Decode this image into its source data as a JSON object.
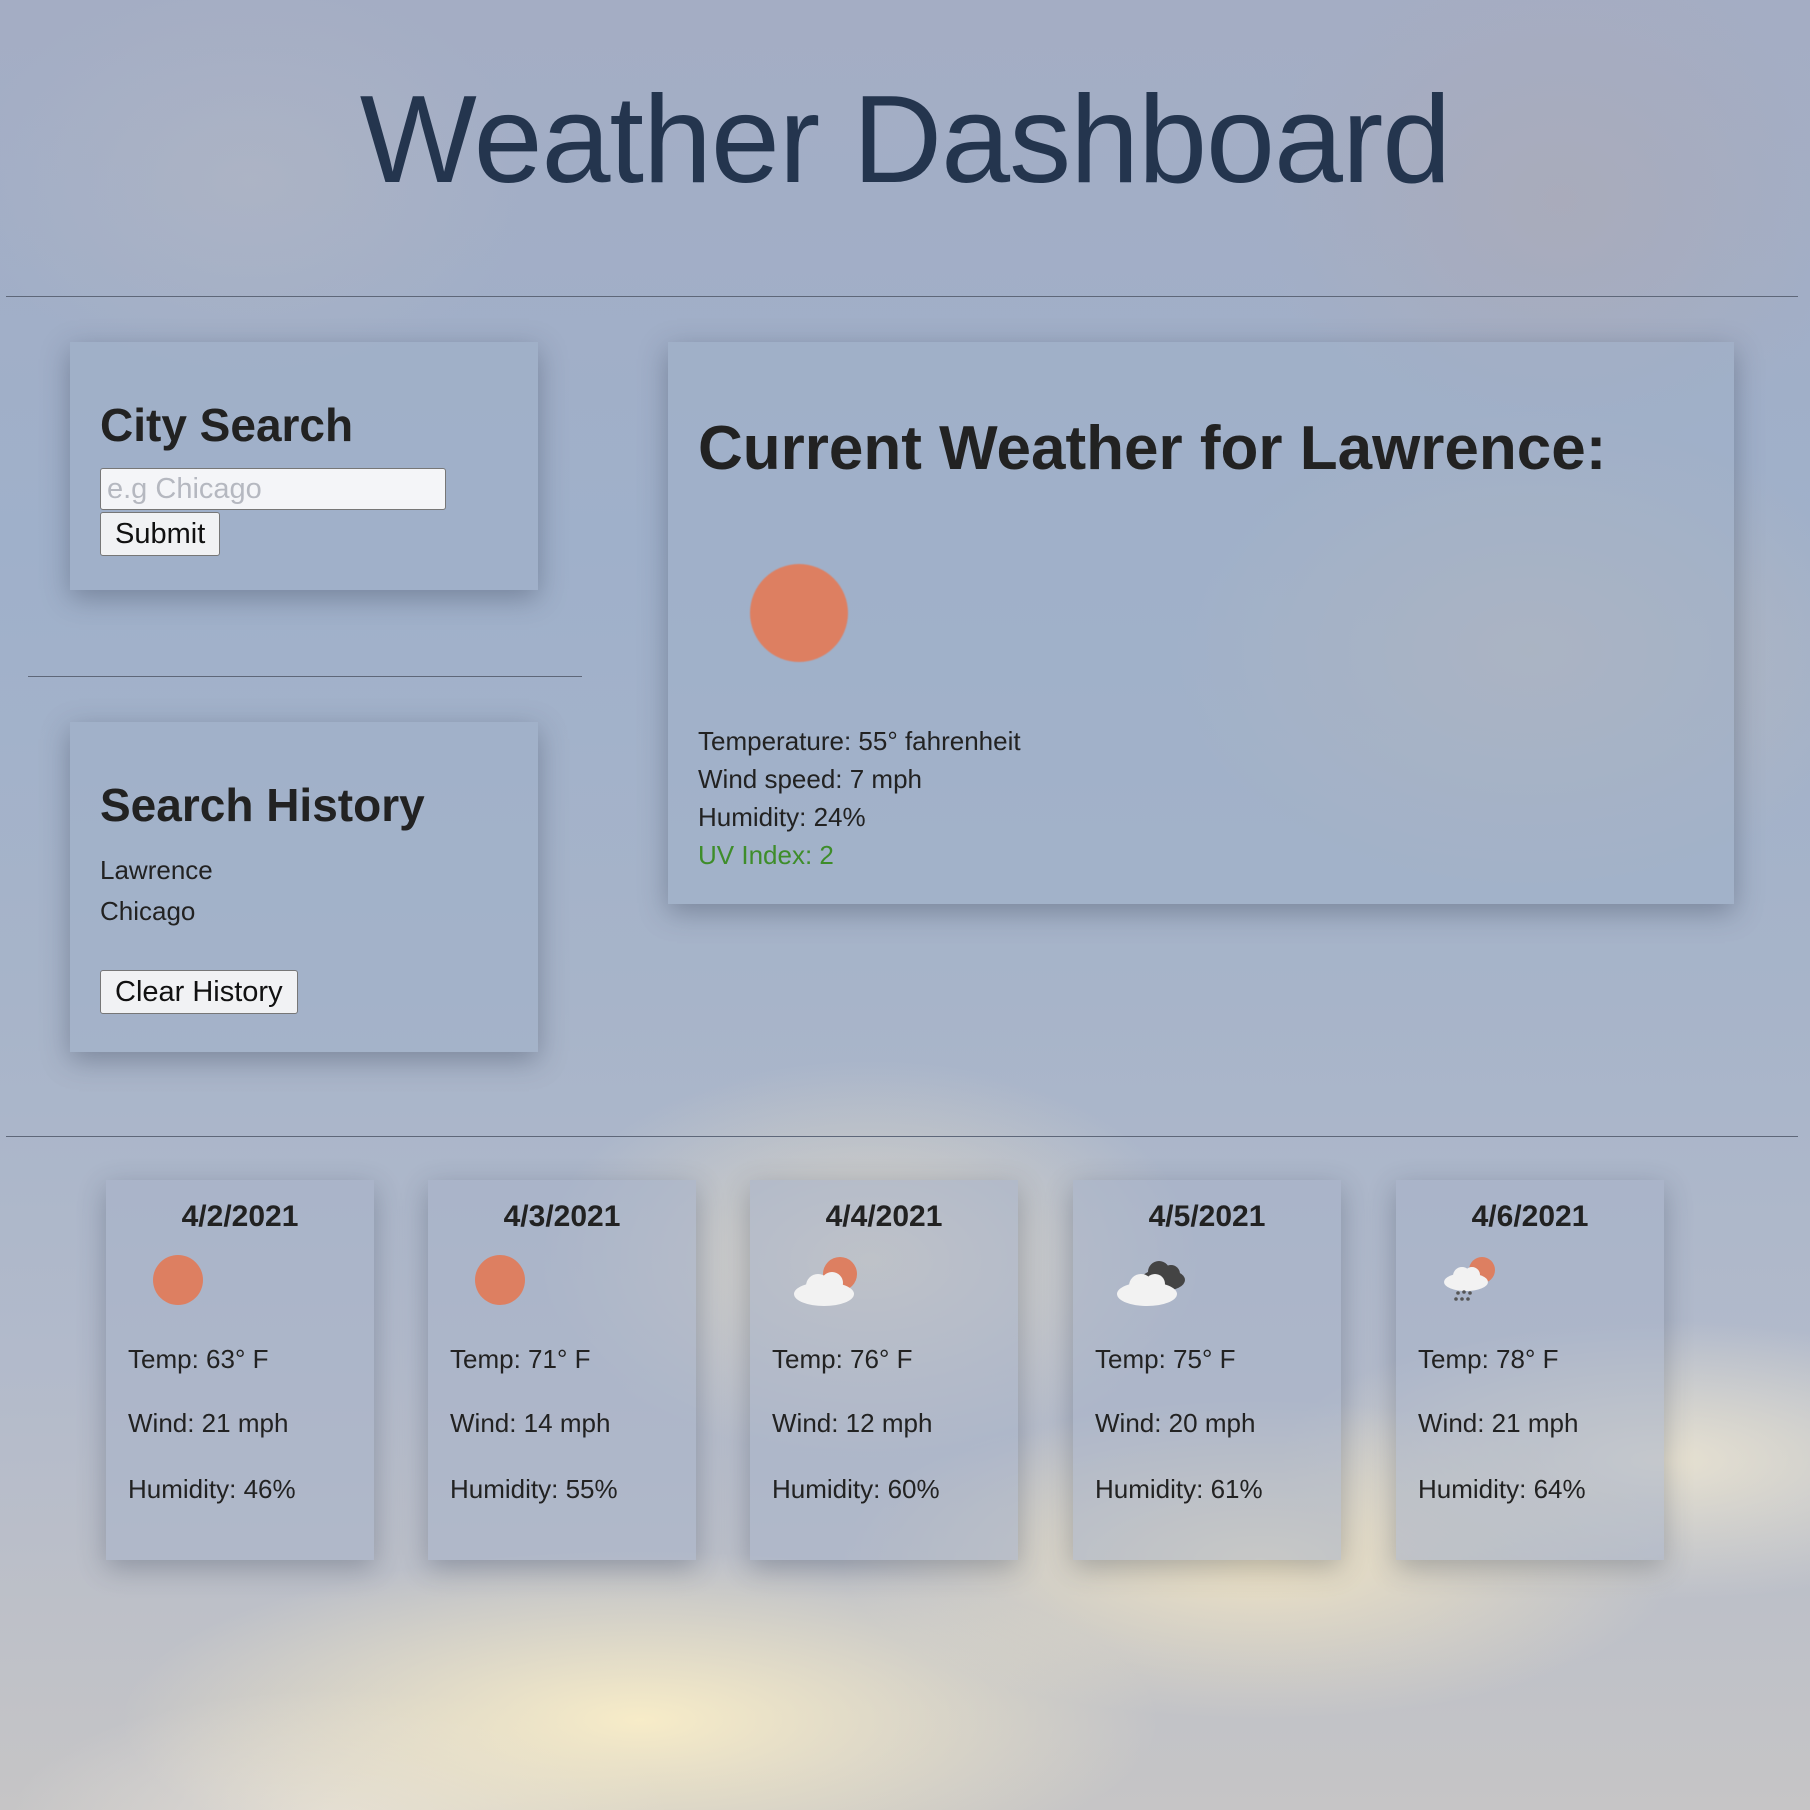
{
  "page": {
    "title": "Weather Dashboard"
  },
  "search": {
    "heading": "City Search",
    "placeholder": "e.g Chicago",
    "submit_label": "Submit"
  },
  "history": {
    "heading": "Search History",
    "items": [
      "Lawrence",
      "Chicago"
    ],
    "clear_label": "Clear History"
  },
  "current": {
    "heading": "Current Weather for Lawrence:",
    "icon": "sun-icon",
    "temperature": "Temperature: 55° fahrenheit",
    "wind": "Wind speed: 7 mph",
    "humidity": "Humidity: 24%",
    "uv": "UV Index: 2",
    "uv_color": "#3e8d2a"
  },
  "forecast": [
    {
      "date": "4/2/2021",
      "icon": "sun-icon",
      "temp": "Temp: 63° F",
      "wind": "Wind: 21 mph",
      "humidity": "Humidity: 46%"
    },
    {
      "date": "4/3/2021",
      "icon": "sun-icon",
      "temp": "Temp: 71° F",
      "wind": "Wind: 14 mph",
      "humidity": "Humidity: 55%"
    },
    {
      "date": "4/4/2021",
      "icon": "partly-cloudy-icon",
      "temp": "Temp: 76° F",
      "wind": "Wind: 12 mph",
      "humidity": "Humidity: 60%"
    },
    {
      "date": "4/5/2021",
      "icon": "cloudy-icon",
      "temp": "Temp: 75° F",
      "wind": "Wind: 20 mph",
      "humidity": "Humidity: 61%"
    },
    {
      "date": "4/6/2021",
      "icon": "rain-sun-icon",
      "temp": "Temp: 78° F",
      "wind": "Wind: 21 mph",
      "humidity": "Humidity: 64%"
    }
  ],
  "colors": {
    "sun": "#dd7f61",
    "title": "#24354e"
  }
}
